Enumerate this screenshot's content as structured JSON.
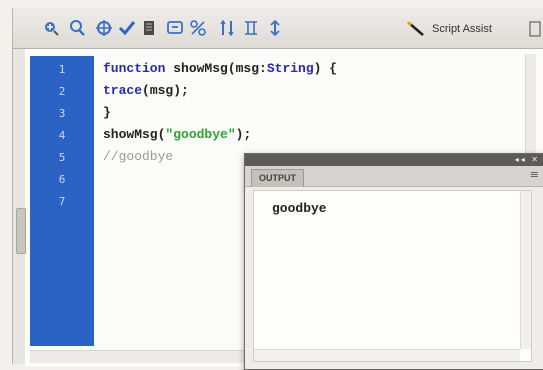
{
  "toolbar": {
    "icons": [
      "add-statement-icon",
      "find-icon",
      "insert-target-path-icon",
      "check-syntax-icon",
      "auto-format-icon",
      "code-hint-icon",
      "debug-options-icon",
      "collapse-between-braces-icon",
      "collapse-selection-icon",
      "expand-all-icon"
    ],
    "script_assist_label": "Script Assist"
  },
  "editor": {
    "line_numbers": [
      "1",
      "2",
      "3",
      "4",
      "5",
      "6",
      "7"
    ],
    "code": {
      "l1_kw": "function",
      "l1_rest": " showMsg(msg:",
      "l1_type": "String",
      "l1_end": ") {",
      "l2_fn": "trace",
      "l2_rest": "(msg);",
      "l3": "}",
      "l4_a": "showMsg(",
      "l4_str": "\"goodbye\"",
      "l4_b": ");",
      "l5": "//goodbye"
    }
  },
  "output_panel": {
    "tab_label": "OUTPUT",
    "text": "goodbye"
  },
  "colors": {
    "gutter": "#2a63c4",
    "keyword": "#2a2ab0",
    "string": "#2fa32f",
    "comment": "#9a9a9a"
  }
}
